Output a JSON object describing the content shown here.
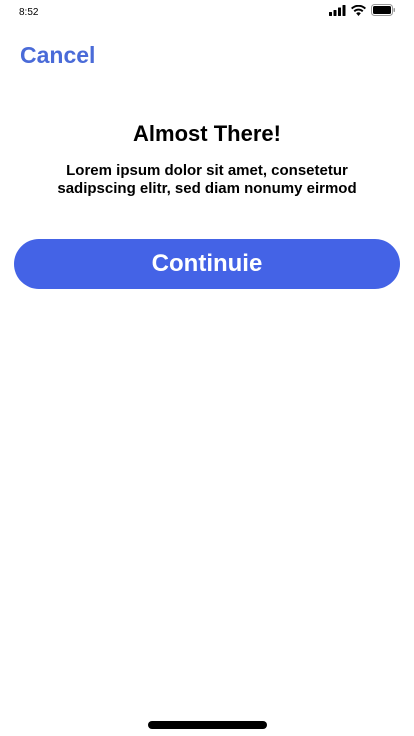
{
  "status_bar": {
    "time": "8:52",
    "icons": [
      "signal-icon",
      "wifi-icon",
      "battery-icon"
    ]
  },
  "header": {
    "cancel_label": "Cancel"
  },
  "main": {
    "title": "Almost There!",
    "subtitle": "Lorem ipsum dolor sit amet, consetetur sadipscing elitr, sed diam nonumy eirmod",
    "continue_label": "Continuie"
  },
  "colors": {
    "accent_text": "#4a6bd8",
    "button_background": "#4463e6",
    "button_text": "#ffffff",
    "background": "#ffffff"
  }
}
